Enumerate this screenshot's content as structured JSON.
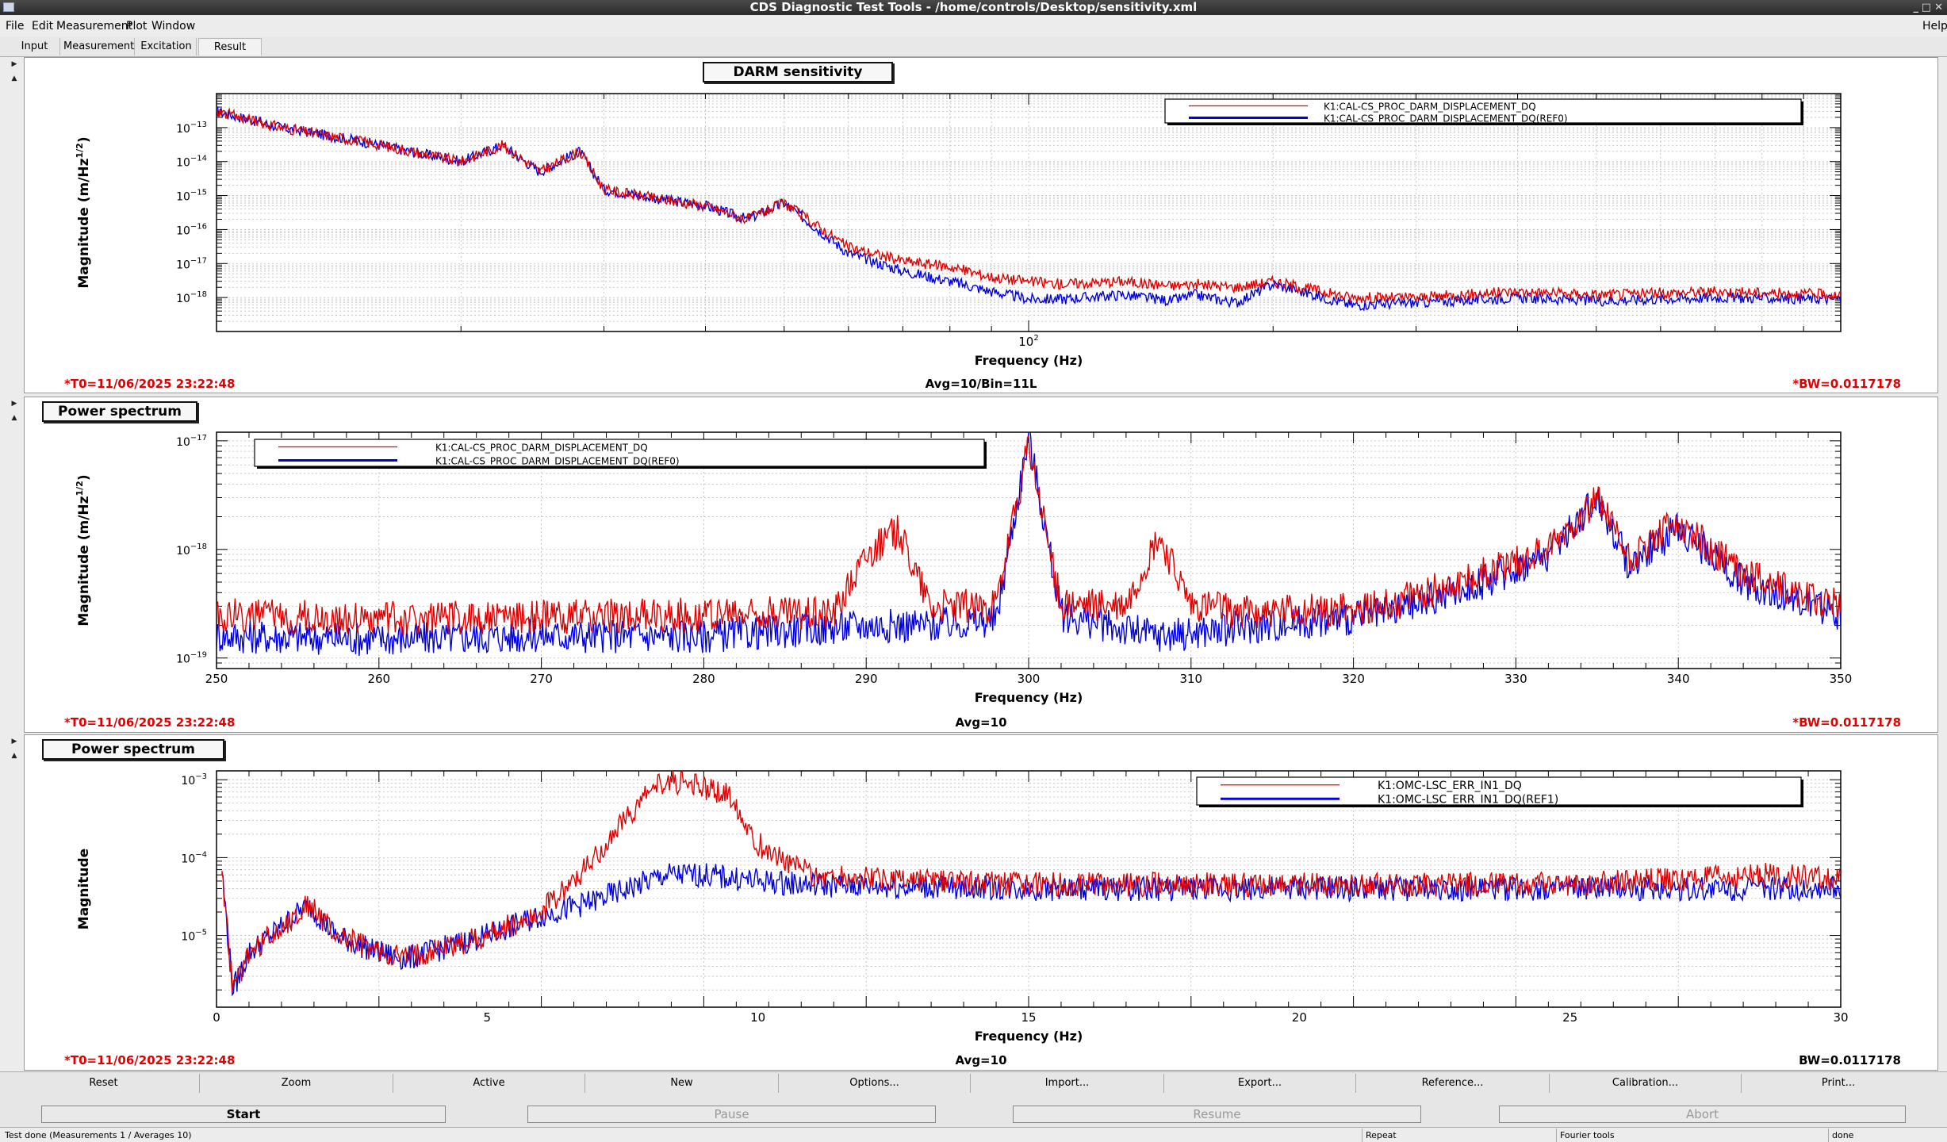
{
  "window": {
    "title": "CDS Diagnostic Test Tools - /home/controls/Desktop/sensitivity.xml"
  },
  "menu": {
    "file": "File",
    "edit": "Edit",
    "measurement": "Measurement",
    "plot": "Plot",
    "window": "Window",
    "help": "Help"
  },
  "tabs": [
    "Input",
    "Measurement",
    "Excitation",
    "Result"
  ],
  "colors": {
    "ref": "#e00000",
    "live": "#0000e0",
    "footer_red": "#e00000"
  },
  "plots": [
    {
      "title": "DARM sensitivity",
      "ylabel": "Magnitude (m/Hz",
      "ylabel_sup": "1/2",
      "ylabel_end": ")",
      "xlabel": "Frequency (Hz)",
      "legend": [
        "K1:CAL-CS_PROC_DARM_DISPLACEMENT_DQ",
        "K1:CAL-CS_PROC_DARM_DISPLACEMENT_DQ(REF0)"
      ],
      "footer_left": "*T0=11/06/2025 23:22:48",
      "footer_center": "Avg=10/Bin=11L",
      "footer_right": "*BW=0.0117178"
    },
    {
      "title": "Power spectrum",
      "ylabel": "Magnitude (m/Hz",
      "ylabel_sup": "1/2",
      "ylabel_end": ")",
      "xlabel": "Frequency (Hz)",
      "legend": [
        "K1:CAL-CS_PROC_DARM_DISPLACEMENT_DQ",
        "K1:CAL-CS_PROC_DARM_DISPLACEMENT_DQ(REF0)"
      ],
      "footer_left": "*T0=11/06/2025 23:22:48",
      "footer_center": "Avg=10",
      "footer_right": "*BW=0.0117178"
    },
    {
      "title": "Power spectrum",
      "ylabel": "Magnitude",
      "ylabel_sup": "",
      "ylabel_end": "",
      "xlabel": "Frequency (Hz)",
      "legend": [
        "K1:OMC-LSC_ERR_IN1_DQ",
        "K1:OMC-LSC_ERR_IN1_DQ(REF1)"
      ],
      "footer_left": "*T0=11/06/2025 23:22:48",
      "footer_center": "Avg=10",
      "footer_right": "BW=0.0117178"
    }
  ],
  "chart_data": [
    {
      "type": "line",
      "title": "DARM sensitivity",
      "xlabel": "Frequency (Hz)",
      "ylabel": "Magnitude (m/Hz^1/2)",
      "xscale": "log",
      "yscale": "log",
      "xlim": [
        10,
        1000
      ],
      "ylim": [
        1e-19,
        1e-12
      ],
      "x_tick_labels": [
        "10^2"
      ],
      "y_tick_labels": [
        "10^-13",
        "10^-14",
        "10^-15",
        "10^-16",
        "10^-17",
        "10^-18"
      ],
      "grid": true,
      "legend_position": "top-right",
      "series": [
        {
          "name": "K1:CAL-CS_PROC_DARM_DISPLACEMENT_DQ",
          "color": "#e00000",
          "x": [
            10,
            12,
            15,
            20,
            22.5,
            25,
            28,
            30,
            35,
            40,
            45,
            50,
            60,
            70,
            80,
            90,
            100,
            110,
            130,
            150,
            160,
            180,
            200,
            250,
            300,
            400,
            500,
            700,
            1000
          ],
          "y": [
            3e-13,
            1e-13,
            4e-14,
            1e-14,
            3e-14,
            5e-15,
            2e-14,
            1.5e-15,
            8e-16,
            5e-16,
            2e-16,
            6e-16,
            3e-17,
            1.2e-17,
            8e-18,
            4e-18,
            3e-18,
            2.5e-18,
            3e-18,
            2.2e-18,
            2.5e-18,
            2e-18,
            3e-18,
            1e-18,
            1e-18,
            1.5e-18,
            1.2e-18,
            1.5e-18,
            1.2e-18
          ]
        },
        {
          "name": "K1:CAL-CS_PROC_DARM_DISPLACEMENT_DQ(REF0)",
          "color": "#0000e0",
          "x": [
            10,
            12,
            15,
            20,
            22.5,
            25,
            28,
            30,
            35,
            40,
            45,
            50,
            60,
            70,
            80,
            90,
            100,
            110,
            130,
            150,
            160,
            180,
            200,
            250,
            300,
            400,
            500,
            700,
            1000
          ],
          "y": [
            3e-13,
            1e-13,
            4e-14,
            1e-14,
            3e-14,
            5e-15,
            2e-14,
            1.5e-15,
            8e-16,
            5e-16,
            2e-16,
            6e-16,
            2e-17,
            6e-18,
            3e-18,
            1.5e-18,
            9e-19,
            9e-19,
            1.2e-18,
            8e-19,
            1.2e-18,
            7e-19,
            2.5e-18,
            6e-19,
            7e-19,
            1e-18,
            8e-19,
            1e-18,
            9e-19
          ]
        }
      ]
    },
    {
      "type": "line",
      "title": "Power spectrum",
      "xlabel": "Frequency (Hz)",
      "ylabel": "Magnitude (m/Hz^1/2)",
      "xscale": "linear",
      "yscale": "log",
      "xlim": [
        250,
        350
      ],
      "ylim": [
        8e-20,
        1.2e-17
      ],
      "x_tick_labels": [
        "250",
        "260",
        "270",
        "280",
        "290",
        "300",
        "310",
        "320",
        "330",
        "340",
        "350"
      ],
      "y_tick_labels": [
        "10^-17",
        "10^-18",
        "10^-19"
      ],
      "grid": true,
      "legend_position": "top-left",
      "series": [
        {
          "name": "K1:CAL-CS_PROC_DARM_DISPLACEMENT_DQ",
          "color": "#e00000",
          "x": [
            250,
            260,
            270,
            280,
            288,
            290,
            292,
            294,
            298,
            300,
            302,
            306,
            308,
            310,
            315,
            322,
            328,
            332,
            335,
            337,
            340,
            344,
            350
          ],
          "y": [
            2.5e-19,
            2.3e-19,
            2.4e-19,
            2.5e-19,
            2.7e-19,
            9e-19,
            1.5e-18,
            3e-19,
            3e-19,
            9e-18,
            3e-19,
            3e-19,
            1.3e-18,
            3e-19,
            2.6e-19,
            3e-19,
            6e-19,
            1e-18,
            3e-18,
            8e-19,
            1.8e-18,
            6e-19,
            3e-19
          ]
        },
        {
          "name": "K1:CAL-CS_PROC_DARM_DISPLACEMENT_DQ(REF0)",
          "color": "#0000e0",
          "x": [
            250,
            260,
            270,
            280,
            288,
            290,
            292,
            294,
            298,
            300,
            302,
            306,
            308,
            310,
            315,
            322,
            328,
            332,
            335,
            337,
            340,
            344,
            350
          ],
          "y": [
            1.6e-19,
            1.5e-19,
            1.6e-19,
            1.6e-19,
            1.9e-19,
            2e-19,
            2e-19,
            2e-19,
            2.2e-19,
            1.1e-17,
            2.5e-19,
            1.8e-19,
            1.6e-19,
            1.7e-19,
            2e-19,
            2.5e-19,
            5e-19,
            9e-19,
            3e-18,
            7e-19,
            1.6e-18,
            5e-19,
            2.5e-19
          ]
        }
      ]
    },
    {
      "type": "line",
      "title": "Power spectrum",
      "xlabel": "Frequency (Hz)",
      "ylabel": "Magnitude",
      "xscale": "linear",
      "yscale": "log",
      "xlim": [
        0,
        30
      ],
      "ylim": [
        1.2e-06,
        0.0013
      ],
      "x_tick_labels": [
        "0",
        "5",
        "10",
        "15",
        "20",
        "25",
        "30"
      ],
      "y_tick_labels": [
        "10^-3",
        "10^-4",
        "10^-5"
      ],
      "grid": true,
      "legend_position": "top-right",
      "series": [
        {
          "name": "K1:OMC-LSC_ERR_IN1_DQ",
          "color": "#e00000",
          "x": [
            0.1,
            0.3,
            0.6,
            1.0,
            1.7,
            2.2,
            3.0,
            3.5,
            5.0,
            6.0,
            7.0,
            7.8,
            8.3,
            9.0,
            9.5,
            10.0,
            11,
            13,
            15,
            20,
            25,
            28.8,
            30
          ],
          "y": [
            7e-05,
            2e-06,
            6e-06,
            1e-05,
            2.5e-05,
            1e-05,
            6e-06,
            5e-06,
            1e-05,
            2e-05,
            0.0001,
            0.0005,
            0.001,
            0.0008,
            0.0006,
            0.00015,
            6e-05,
            5e-05,
            4.5e-05,
            4.5e-05,
            4.5e-05,
            6e-05,
            5e-05
          ]
        },
        {
          "name": "K1:OMC-LSC_ERR_IN1_DQ(REF1)",
          "color": "#0000e0",
          "x": [
            0.1,
            0.3,
            0.6,
            1.0,
            1.7,
            2.2,
            3.0,
            3.5,
            5.0,
            6.0,
            7.0,
            7.8,
            8.3,
            9.0,
            9.5,
            10.0,
            11,
            13,
            15,
            20,
            25,
            28.8,
            30
          ],
          "y": [
            7e-05,
            2e-06,
            6e-06,
            1e-05,
            2.5e-05,
            1e-05,
            6e-06,
            5e-06,
            1e-05,
            1.8e-05,
            2.8e-05,
            4.5e-05,
            6e-05,
            6e-05,
            5.5e-05,
            5e-05,
            4.5e-05,
            4.2e-05,
            4e-05,
            4e-05,
            4e-05,
            4e-05,
            4e-05
          ]
        }
      ]
    }
  ],
  "buttons_row1": [
    "Reset",
    "Zoom",
    "Active",
    "New",
    "Options...",
    "Import...",
    "Export...",
    "Reference...",
    "Calibration...",
    "Print..."
  ],
  "buttons_row2": [
    "Start",
    "Pause",
    "Resume",
    "Abort"
  ],
  "status": {
    "message": "Test done (Measurements 1 / Averages 10)",
    "repeat": "Repeat",
    "fourier": "Fourier tools",
    "state": "done"
  }
}
